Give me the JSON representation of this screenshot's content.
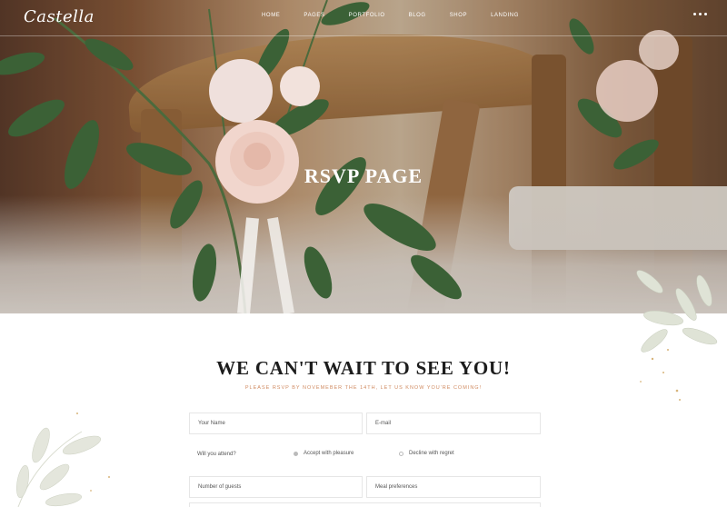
{
  "brand": {
    "logo": "Castella"
  },
  "nav": {
    "items": [
      "HOME",
      "PAGES",
      "PORTFOLIO",
      "BLOG",
      "SHOP",
      "LANDING"
    ]
  },
  "hero": {
    "title": "RSVP PAGE"
  },
  "rsvp": {
    "heading": "WE CAN'T WAIT TO SEE YOU!",
    "subheading": "PLEASE RSVP BY NOVEMEBER THE 14TH, LET US KNOW YOU'RE COMING!",
    "name_placeholder": "Your Name",
    "email_placeholder": "E-mail",
    "attend_question": "Will you attend?",
    "attend_yes": "Accept with pleasure",
    "attend_no": "Decline with regret",
    "guests_placeholder": "Number of guests",
    "meal_placeholder": "Meal preferences"
  },
  "colors": {
    "accent": "#d08a60",
    "foliage": "#3f6b3f",
    "rose": "#f1d6cd"
  }
}
